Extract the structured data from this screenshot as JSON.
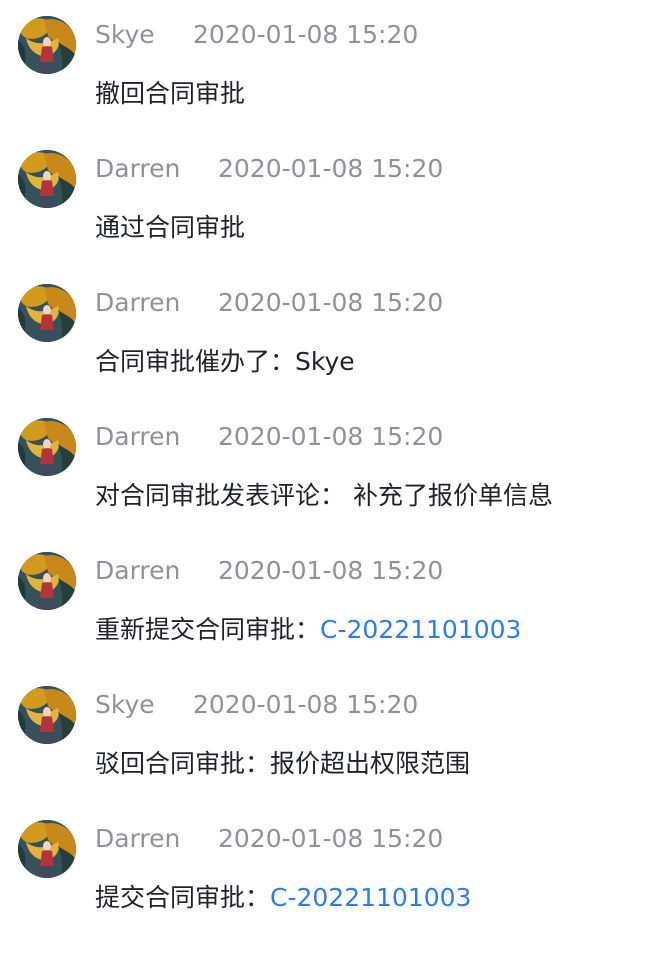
{
  "activity": [
    {
      "author": "Skye",
      "time": "2020-01-08 15:20",
      "message": "撤回合同审批",
      "link": ""
    },
    {
      "author": "Darren",
      "time": "2020-01-08 15:20",
      "message": "通过合同审批",
      "link": ""
    },
    {
      "author": "Darren",
      "time": "2020-01-08 15:20",
      "message": "合同审批催办了：Skye",
      "link": ""
    },
    {
      "author": "Darren",
      "time": "2020-01-08 15:20",
      "message": "对合同审批发表评论： 补充了报价单信息",
      "link": ""
    },
    {
      "author": "Darren",
      "time": "2020-01-08 15:20",
      "message": "重新提交合同审批：",
      "link": "C-20221101003"
    },
    {
      "author": "Skye",
      "time": "2020-01-08 15:20",
      "message": "驳回合同审批：报价超出权限范围",
      "link": ""
    },
    {
      "author": "Darren",
      "time": "2020-01-08 15:20",
      "message": "提交合同审批：",
      "link": "C-20221101003"
    }
  ]
}
